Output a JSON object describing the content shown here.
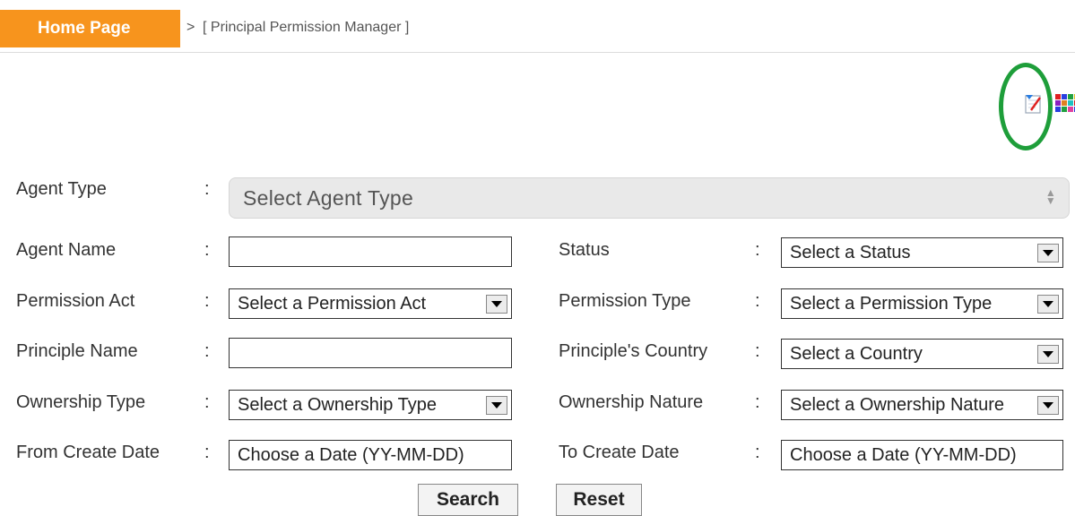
{
  "header": {
    "home_label": "Home Page",
    "separator": ">",
    "breadcrumb": "[ Principal Permission Manager ]"
  },
  "toolbar": {
    "icons": [
      "edit-icon",
      "color-grid-icon"
    ],
    "highlight_color": "#1e9e3a"
  },
  "form": {
    "colon": ":",
    "agent_type": {
      "label": "Agent Type",
      "value": "Select Agent Type"
    },
    "agent_name": {
      "label": "Agent Name",
      "value": ""
    },
    "status": {
      "label": "Status",
      "value": "Select a Status"
    },
    "permission_act": {
      "label": "Permission Act",
      "value": "Select a Permission Act"
    },
    "permission_type": {
      "label": "Permission Type",
      "value": "Select a Permission Type"
    },
    "principle_name": {
      "label": "Principle Name",
      "value": ""
    },
    "principle_country": {
      "label": "Principle's Country",
      "value": "Select a Country"
    },
    "ownership_type": {
      "label": "Ownership Type",
      "value": "Select a Ownership Type"
    },
    "ownership_nature": {
      "label": "Ownership Nature",
      "value": "Select a Ownership Nature"
    },
    "from_create_date": {
      "label": "From Create Date",
      "value": "Choose a Date (YY-MM-DD)"
    },
    "to_create_date": {
      "label": "To Create Date",
      "value": "Choose a Date (YY-MM-DD)"
    }
  },
  "actions": {
    "search_label": "Search",
    "reset_label": "Reset"
  },
  "colors": {
    "accent": "#f7941d"
  }
}
